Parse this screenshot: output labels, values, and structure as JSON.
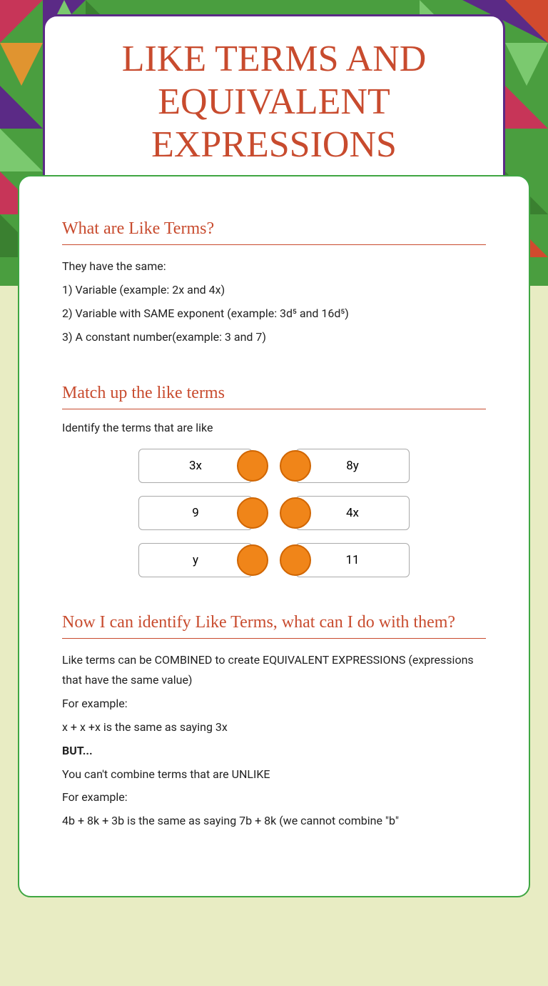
{
  "title": "LIKE TERMS AND EQUIVALENT EXPRESSIONS",
  "section1": {
    "heading": "What are Like Terms?",
    "lines": [
      "They have the same:",
      "1) Variable (example: 2x and 4x)",
      "2) Variable with SAME exponent (example: 3d⁵ and 16d⁵)",
      "3) A constant number(example: 3 and 7)"
    ]
  },
  "section2": {
    "heading": "Match up the like terms",
    "subtitle": "Identify the terms that are like",
    "left": [
      "3x",
      "9",
      "y"
    ],
    "right": [
      "8y",
      "4x",
      "11"
    ]
  },
  "section3": {
    "heading": "Now I can identify Like Terms, what can I do with them?",
    "lines": [
      {
        "text": "Like terms can be COMBINED to create EQUIVALENT EXPRESSIONS (expressions that have the same value)",
        "bold": false
      },
      {
        "text": "For example:",
        "bold": false
      },
      {
        "text": "x + x +x is the same as saying 3x",
        "bold": false
      },
      {
        "text": "BUT...",
        "bold": true
      },
      {
        "text": "You can't combine terms that are UNLIKE",
        "bold": false
      },
      {
        "text": "For example:",
        "bold": false
      },
      {
        "text": "4b + 8k + 3b is the same as saying 7b + 8k (we cannot combine \"b\"",
        "bold": false
      }
    ]
  }
}
